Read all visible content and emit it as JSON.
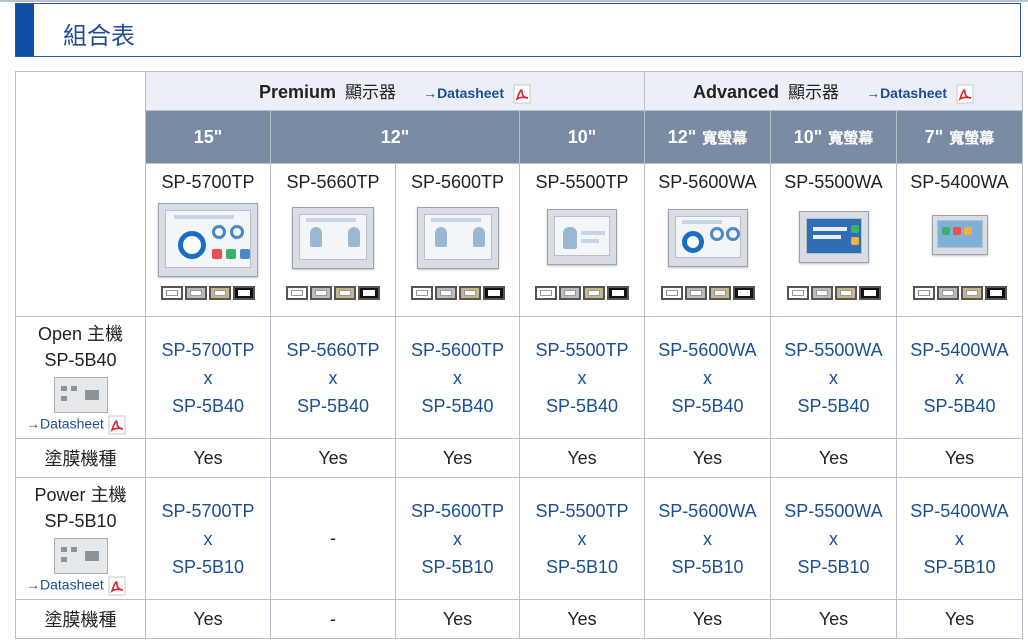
{
  "page": {
    "section_title": "組合表"
  },
  "series": [
    {
      "name": "Premium",
      "suffix": "顯示器",
      "datasheet": "→Datasheet"
    },
    {
      "name": "Advanced",
      "suffix": "顯示器",
      "datasheet": "→Datasheet"
    }
  ],
  "sizes": [
    {
      "size": "15\"",
      "wide": ""
    },
    {
      "size": "12\"",
      "wide": ""
    },
    {
      "size": "10\"",
      "wide": ""
    },
    {
      "size": "12\"",
      "wide": "寬螢幕"
    },
    {
      "size": "10\"",
      "wide": "寬螢幕"
    },
    {
      "size": "7\"",
      "wide": "寬螢幕"
    }
  ],
  "models": [
    "SP-5700TP",
    "SP-5660TP",
    "SP-5600TP",
    "SP-5500TP",
    "SP-5600WA",
    "SP-5500WA",
    "SP-5400WA"
  ],
  "rows": {
    "open": {
      "label": "Open 主機",
      "model": "SP-5B40",
      "datasheet": "→Datasheet",
      "combos": [
        {
          "display": "SP-5700TP",
          "x": "x",
          "host": "SP-5B40"
        },
        {
          "display": "SP-5660TP",
          "x": "x",
          "host": "SP-5B40"
        },
        {
          "display": "SP-5600TP",
          "x": "x",
          "host": "SP-5B40"
        },
        {
          "display": "SP-5500TP",
          "x": "x",
          "host": "SP-5B40"
        },
        {
          "display": "SP-5600WA",
          "x": "x",
          "host": "SP-5B40"
        },
        {
          "display": "SP-5500WA",
          "x": "x",
          "host": "SP-5B40"
        },
        {
          "display": "SP-5400WA",
          "x": "x",
          "host": "SP-5B40"
        }
      ],
      "coating_label": "塗膜機種",
      "coating": [
        "Yes",
        "Yes",
        "Yes",
        "Yes",
        "Yes",
        "Yes",
        "Yes"
      ]
    },
    "power": {
      "label": "Power 主機",
      "model": "SP-5B10",
      "datasheet": "→Datasheet",
      "combos": [
        {
          "display": "SP-5700TP",
          "x": "x",
          "host": "SP-5B10"
        },
        {
          "display": "-",
          "x": "",
          "host": ""
        },
        {
          "display": "SP-5600TP",
          "x": "x",
          "host": "SP-5B10"
        },
        {
          "display": "SP-5500TP",
          "x": "x",
          "host": "SP-5B10"
        },
        {
          "display": "SP-5600WA",
          "x": "x",
          "host": "SP-5B10"
        },
        {
          "display": "SP-5500WA",
          "x": "x",
          "host": "SP-5B10"
        },
        {
          "display": "SP-5400WA",
          "x": "x",
          "host": "SP-5B10"
        }
      ],
      "coating_label": "塗膜機種",
      "coating": [
        "Yes",
        "-",
        "Yes",
        "Yes",
        "Yes",
        "Yes",
        "Yes"
      ]
    }
  },
  "icons": {
    "pdf": "pdf-icon",
    "bezel_options": [
      "silver-bezel",
      "gray-bezel",
      "beige-bezel",
      "black-bezel"
    ]
  }
}
